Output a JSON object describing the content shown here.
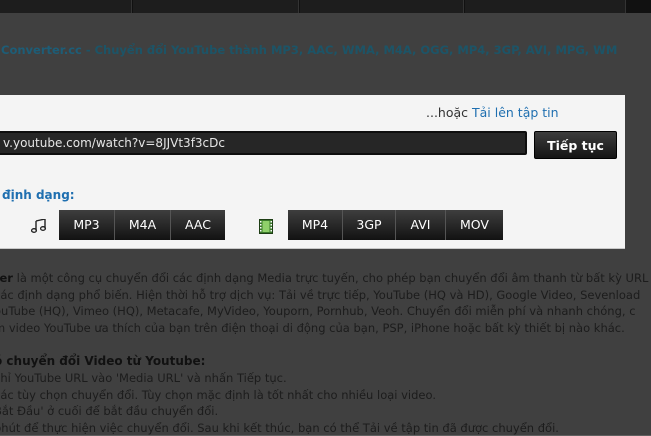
{
  "site": {
    "name": "Converter.cc",
    "tagline": " - Chuyển đổi YouTube thành MP3, AAC, WMA, M4A, OGG, MP4, 3GP, AVI, MPG, WM"
  },
  "converter": {
    "upload_prefix": "...hoặc ",
    "upload_link": "Tải lên tập tin",
    "url_value": "v.youtube.com/watch?v=8JJVt3f3cDc",
    "continue_label": "Tiếp tục",
    "formats_label": "định dạng:",
    "audio_formats": [
      "MP3",
      "M4A",
      "AAC"
    ],
    "video_formats": [
      "MP4",
      "3GP",
      "AVI",
      "MOV"
    ]
  },
  "intro": {
    "lead": "ter",
    "lines": [
      " là một công cụ chuyển đổi các định dạng Media trực tuyến, cho phép bạn chuyển đổi âm thanh từ bất kỳ URL",
      "các định dạng phổ biến. Hiện thời hỗ trợ dịch vụ: Tải về trực tiếp, YouTube (HQ và HD), Google Video, Sevenload",
      "ouTube (HQ), Vimeo (HQ), Metacafe, MyVideo, Youporn, Pornhub, Veoh. Chuyển đổi miễn phí và nhanh chóng, c",
      "m video YouTube ưa thích của bạn trên điện thoại di động của bạn, PSP, iPhone hoặc bất kỳ thiết bị nào khác."
    ]
  },
  "howto": {
    "heading": "ó chuyển đổi Video từ Youtube:",
    "steps": [
      "chỉ YouTube URL vào 'Media URL' và nhấn Tiếp tục.",
      "các tùy chọn chuyển đổi. Tùy chọn mặc định là tốt nhất cho nhiều loại video.",
      "Bắt Đầu' ở cuối để bắt đầu chuyển đổi.",
      "phút để thực hiện việc chuyển đổi. Sau khi kết thúc, bạn có thể Tải về tập tin đã được chuyển đổi."
    ]
  },
  "icons": {
    "audio": "music-note-icon",
    "video": "film-strip-icon"
  }
}
